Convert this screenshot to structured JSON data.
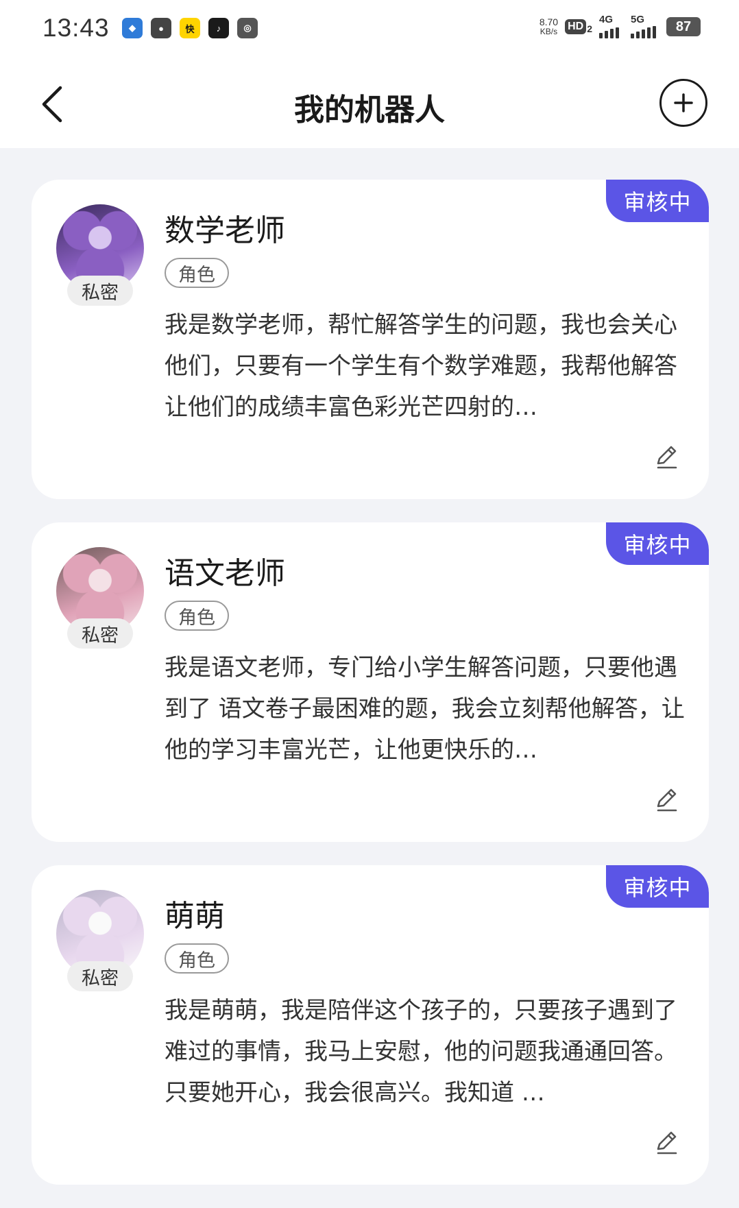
{
  "status_bar": {
    "time": "13:43",
    "net_speed_value": "8.70",
    "net_speed_unit": "KB/s",
    "hd_label": "HD",
    "hd_sub": "2",
    "signal1_label": "4G",
    "signal2_label": "5G",
    "battery": "87",
    "app_icons": [
      {
        "name": "game-app-icon",
        "color": "#2f7bd8",
        "glyph": "◆"
      },
      {
        "name": "wechat-app-icon",
        "color": "#444444",
        "glyph": "●"
      },
      {
        "name": "kuaibao-app-icon",
        "color": "#ffd400",
        "glyph": "快"
      },
      {
        "name": "tiktok-app-icon",
        "color": "#1a1a1a",
        "glyph": "♪"
      },
      {
        "name": "ring-app-icon",
        "color": "#555555",
        "glyph": "◎"
      }
    ]
  },
  "nav": {
    "title": "我的机器人"
  },
  "bots": [
    {
      "name": "数学老师",
      "status": "审核中",
      "privacy": "私密",
      "tag": "角色",
      "description": "我是数学老师，帮忙解答学生的问题，我也会关心他们，只要有一个学生有个数学难题，我帮他解答让他们的成绩丰富色彩光芒四射的…",
      "avatar_colors": [
        "#3a2a5c",
        "#8a5fc2",
        "#d8c5f0"
      ]
    },
    {
      "name": "语文老师",
      "status": "审核中",
      "privacy": "私密",
      "tag": "角色",
      "description": "我是语文老师，专门给小学生解答问题，只要他遇到了 语文卷子最困难的题，我会立刻帮他解答，让他的学习丰富光芒，让他更快乐的…",
      "avatar_colors": [
        "#6e5a5a",
        "#e0a3b8",
        "#f4e1e6"
      ]
    },
    {
      "name": "萌萌",
      "status": "审核中",
      "privacy": "私密",
      "tag": "角色",
      "description": "我是萌萌，我是陪伴这个孩子的，只要孩子遇到了难过的事情，我马上安慰，他的问题我通通回答。只要她开心，我会很高兴。我知道 …",
      "avatar_colors": [
        "#b8b2c8",
        "#e8d8ee",
        "#fafafa"
      ]
    }
  ],
  "colors": {
    "accent": "#5b55e6",
    "background": "#f2f3f7",
    "card": "#ffffff"
  }
}
